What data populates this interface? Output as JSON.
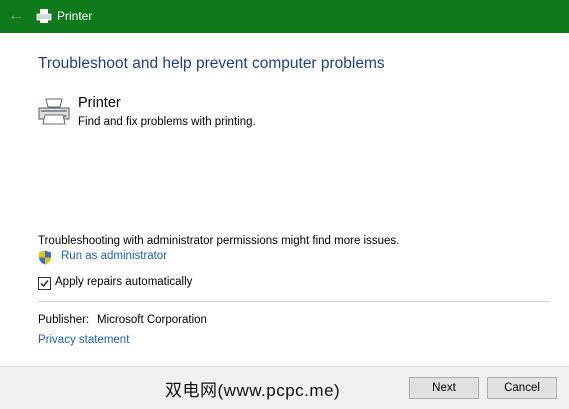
{
  "window": {
    "title": "Printer",
    "titlebar_color": "#0f7a1c"
  },
  "main": {
    "heading": "Troubleshoot and help prevent computer problems",
    "item": {
      "title": "Printer",
      "description": "Find and fix problems with printing.",
      "icon": "printer-icon"
    },
    "admin_note": "Troubleshooting with administrator permissions might find more issues.",
    "run_as_admin_label": "Run as administrator",
    "apply_repairs_label": "Apply repairs automatically",
    "apply_repairs_checked": true,
    "publisher_label": "Publisher:",
    "publisher_value": "Microsoft Corporation",
    "privacy_label": "Privacy statement"
  },
  "footer": {
    "watermark": "双电网(www.pcpc.me)",
    "next_label": "Next",
    "cancel_label": "Cancel"
  },
  "colors": {
    "heading": "#1b3f8f",
    "link": "#1e5ec2"
  }
}
